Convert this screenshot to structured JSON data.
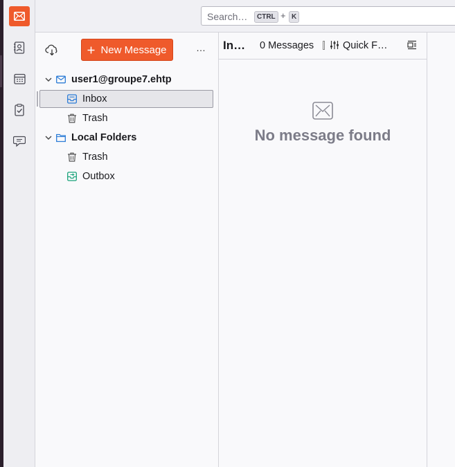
{
  "colors": {
    "accent": "#ef5a2b",
    "sidebar": "#eeeef2",
    "selection": "#e6e6ea"
  },
  "search": {
    "placeholder": "Search…",
    "shortcut_mod": "CTRL",
    "shortcut_plus": "+",
    "shortcut_key": "K"
  },
  "spaces": [
    {
      "name": "mail",
      "icon": "mail-icon"
    },
    {
      "name": "address-book",
      "icon": "address-book-icon"
    },
    {
      "name": "calendar",
      "icon": "calendar-icon"
    },
    {
      "name": "tasks",
      "icon": "tasks-icon"
    },
    {
      "name": "chat",
      "icon": "chat-icon"
    }
  ],
  "folder_pane": {
    "get_messages_icon": "cloud-download-icon",
    "new_message_label": "New Message",
    "more_label": "…",
    "tree": [
      {
        "label": "user1@groupe7.ehtp",
        "type": "account",
        "icon": "envelope-icon",
        "expanded": true
      },
      {
        "label": "Inbox",
        "type": "folder",
        "icon": "inbox-icon",
        "selected": true
      },
      {
        "label": "Trash",
        "type": "folder",
        "icon": "trash-icon"
      },
      {
        "label": "Local Folders",
        "type": "account",
        "icon": "folder-icon",
        "expanded": true
      },
      {
        "label": "Trash",
        "type": "folder",
        "icon": "trash-icon"
      },
      {
        "label": "Outbox",
        "type": "folder",
        "icon": "outbox-icon"
      }
    ]
  },
  "message_list": {
    "folder_title": "In…",
    "count_label": "0 Messages",
    "quick_filter_label": "Quick F…",
    "empty_text": "No message found"
  }
}
